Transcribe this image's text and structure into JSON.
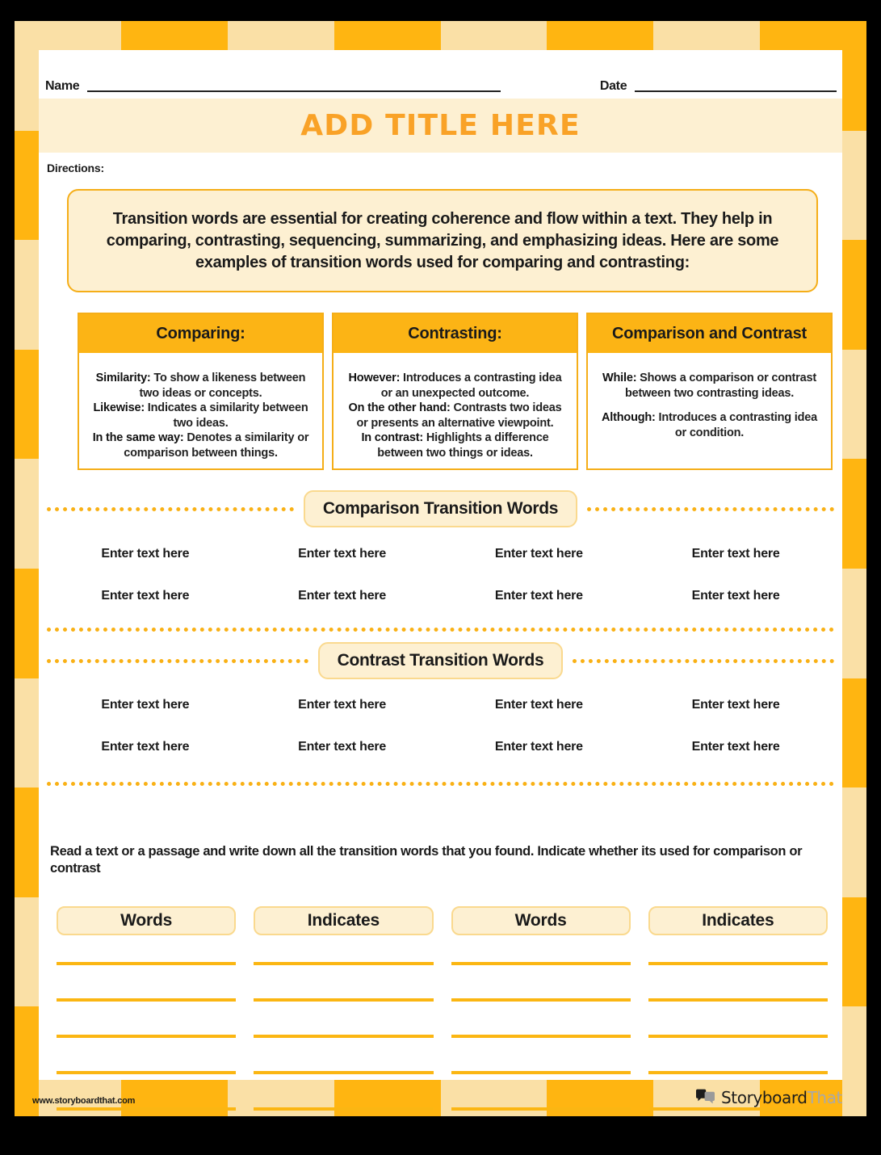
{
  "theme": {
    "orange": "#FFB511",
    "cream": "#FAE0A6",
    "pale_cream": "#FDF0D2",
    "title_orange": "#F9A227",
    "header_orange": "#FCB415",
    "line_orange": "#FBB612",
    "text_dark": "#1A1A1A"
  },
  "header": {
    "name_label": "Name",
    "date_label": "Date",
    "title": "ADD TITLE HERE",
    "directions_label": "Directions:"
  },
  "intro": {
    "lead": "Transition",
    "body": " words are essential for creating coherence and flow within a text. They help in comparing, contrasting, sequencing, summarizing, and emphasizing ideas. Here are some examples of transition words used for comparing and contrasting:"
  },
  "columns": [
    {
      "heading": "Comparing:",
      "entries": [
        {
          "term": "Similarity:",
          "definition": " To show a likeness between two ideas or concepts."
        },
        {
          "term": "Likewise:",
          "definition": " Indicates a similarity between two ideas."
        },
        {
          "term": "In the same way:",
          "definition": " Denotes a similarity or comparison between things."
        }
      ]
    },
    {
      "heading": "Contrasting:",
      "entries": [
        {
          "term": "However:",
          "definition": " Introduces a contrasting idea or an unexpected outcome."
        },
        {
          "term": "On the other hand:",
          "definition": " Contrasts two ideas or presents an alternative viewpoint."
        },
        {
          "term": "In contrast:",
          "definition": " Highlights a difference between two things or ideas."
        }
      ]
    },
    {
      "heading": "Comparison and Contrast",
      "entries": [
        {
          "term": "While:",
          "definition": " Shows a comparison or contrast between two contrasting ideas."
        },
        {
          "term": "Although:",
          "definition": " Introduces a contrasting idea or condition."
        }
      ]
    }
  ],
  "comparison_section": {
    "label": "Comparison Transition Words",
    "placeholder": "Enter text here",
    "cells": [
      "Enter text here",
      "Enter text here",
      "Enter text here",
      "Enter text here",
      "Enter text here",
      "Enter text here",
      "Enter text here",
      "Enter text here"
    ]
  },
  "contrast_section": {
    "label": "Contrast Transition Words",
    "placeholder": "Enter text here",
    "cells": [
      "Enter text here",
      "Enter text here",
      "Enter text here",
      "Enter text here",
      "Enter text here",
      "Enter text here",
      "Enter text here",
      "Enter text here"
    ]
  },
  "prompt": "Read a text or a passage and write down all the transition words that you found. Indicate whether its used for comparison or contrast",
  "table": {
    "headers": [
      "Words",
      "Indicates",
      "Words",
      "Indicates"
    ],
    "rows_per_column": 5
  },
  "footer": {
    "url": "www.storyboardthat.com",
    "logo_primary": "Storyboard",
    "logo_secondary": "That",
    "logo_icon": "speech-bubbles-icon"
  },
  "border_blocks": {
    "top": [
      "cream",
      "orange",
      "cream",
      "orange",
      "cream",
      "orange",
      "cream",
      "orange"
    ],
    "bottom": [
      "cream",
      "orange",
      "cream",
      "orange",
      "cream",
      "orange",
      "cream",
      "orange"
    ],
    "left": [
      "cream",
      "orange",
      "cream",
      "orange",
      "cream",
      "orange",
      "cream",
      "orange",
      "cream",
      "orange"
    ],
    "right": [
      "orange",
      "cream",
      "orange",
      "cream",
      "orange",
      "cream",
      "orange",
      "cream",
      "orange",
      "cream"
    ]
  }
}
